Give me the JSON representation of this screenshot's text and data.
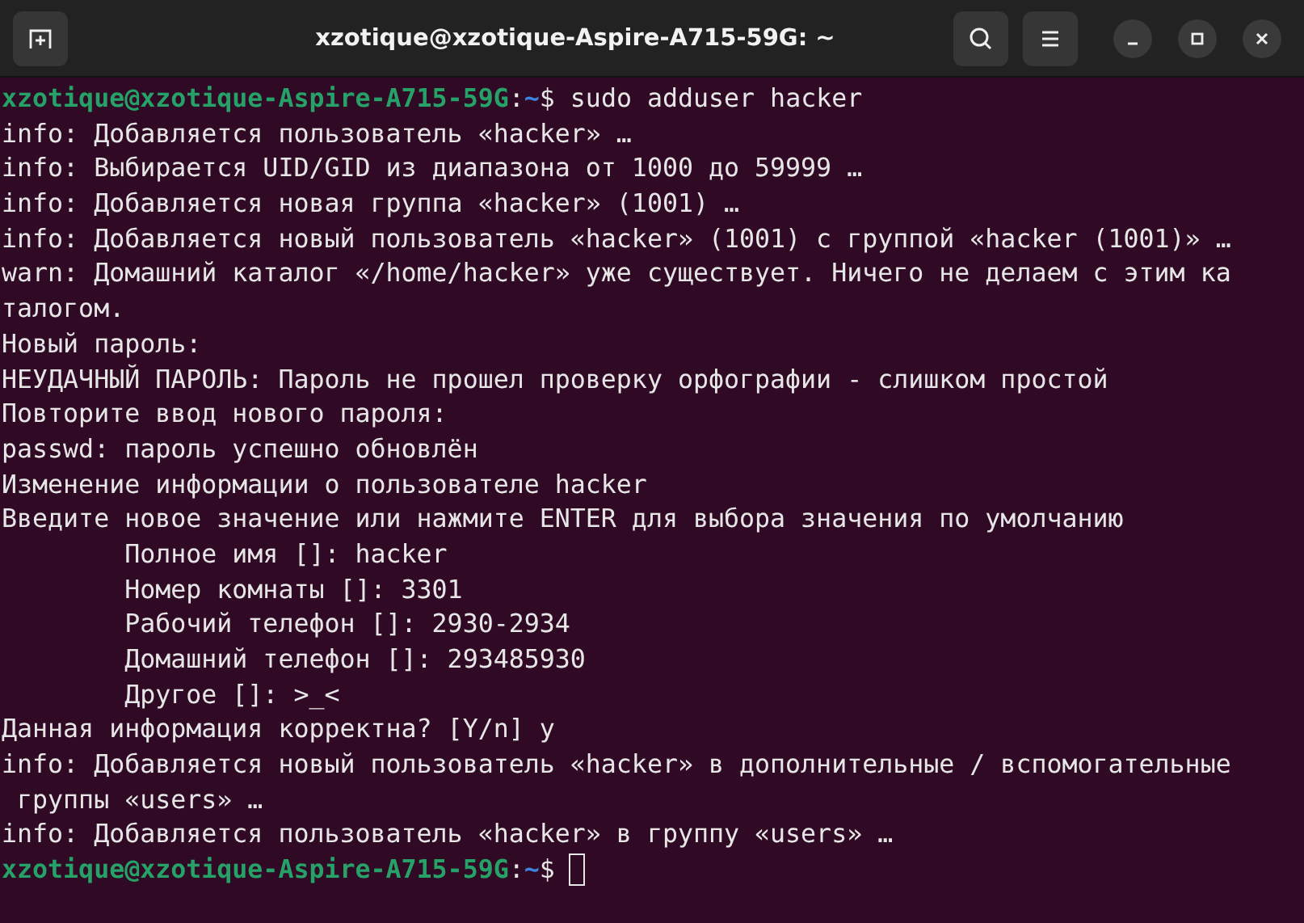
{
  "window": {
    "title": "xzotique@xzotique-Aspire-A715-59G: ~"
  },
  "terminal": {
    "lines": [
      {
        "kind": "prompt",
        "user_host": "xzotique@xzotique-Aspire-A715-59G",
        "separator": ":",
        "path": "~",
        "symbol": "$",
        "command": " sudo adduser hacker",
        "cursor": false
      },
      {
        "kind": "output",
        "text": "info: Добавляется пользователь «hacker» …"
      },
      {
        "kind": "output",
        "text": "info: Выбирается UID/GID из диапазона от 1000 до 59999 …"
      },
      {
        "kind": "output",
        "text": "info: Добавляется новая группа «hacker» (1001) …"
      },
      {
        "kind": "output",
        "text": "info: Добавляется новый пользователь «hacker» (1001) с группой «hacker (1001)» …"
      },
      {
        "kind": "output",
        "text": "warn: Домашний каталог «/home/hacker» уже существует. Ничего не делаем с этим ка"
      },
      {
        "kind": "output",
        "text": "талогом."
      },
      {
        "kind": "output",
        "text": "Новый пароль:"
      },
      {
        "kind": "output",
        "text": "НЕУДАЧНЫЙ ПАРОЛЬ: Пароль не прошел проверку орфографии - слишком простой"
      },
      {
        "kind": "output",
        "text": "Повторите ввод нового пароля:"
      },
      {
        "kind": "output",
        "text": "passwd: пароль успешно обновлён"
      },
      {
        "kind": "output",
        "text": "Изменение информации о пользователе hacker"
      },
      {
        "kind": "output",
        "text": "Введите новое значение или нажмите ENTER для выбора значения по умолчанию"
      },
      {
        "kind": "output",
        "text": "        Полное имя []: hacker"
      },
      {
        "kind": "output",
        "text": "        Номер комнаты []: 3301"
      },
      {
        "kind": "output",
        "text": "        Рабочий телефон []: 2930-2934"
      },
      {
        "kind": "output",
        "text": "        Домашний телефон []: 293485930"
      },
      {
        "kind": "output",
        "text": "        Другое []: >_<"
      },
      {
        "kind": "output",
        "text": "Данная информация корректна? [Y/n] y"
      },
      {
        "kind": "output",
        "text": "info: Добавляется новый пользователь «hacker» в дополнительные / вспомогательные"
      },
      {
        "kind": "output",
        "text": " группы «users» …"
      },
      {
        "kind": "output",
        "text": "info: Добавляется пользователь «hacker» в группу «users» …"
      },
      {
        "kind": "prompt",
        "user_host": "xzotique@xzotique-Aspire-A715-59G",
        "separator": ":",
        "path": "~",
        "symbol": "$",
        "cursor": true
      }
    ]
  }
}
